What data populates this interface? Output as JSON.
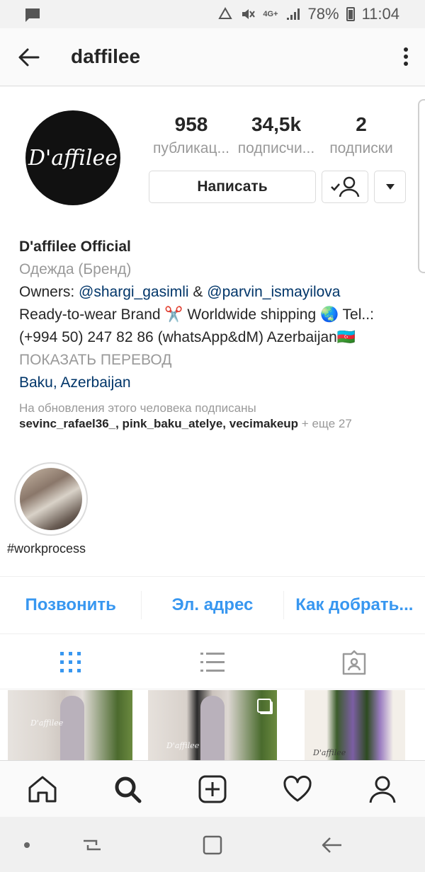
{
  "status_bar": {
    "battery": "78%",
    "time": "11:04",
    "network": "4G+"
  },
  "app_bar": {
    "username": "daffilee"
  },
  "profile": {
    "avatar_text": "D'affilee",
    "stats": [
      {
        "value": "958",
        "label": "публикац..."
      },
      {
        "value": "34,5k",
        "label": "подписчи..."
      },
      {
        "value": "2",
        "label": "подписки"
      }
    ],
    "message_button": "Написать"
  },
  "bio": {
    "name": "D'affilee Official",
    "category": "Одежда (Бренд)",
    "owners_prefix": "Owners: ",
    "owner1": "@shargi_gasimli",
    "owners_amp": " & ",
    "owner2": "@parvin_ismayilova",
    "line3": "Ready-to-wear Brand ✂️ Worldwide shipping 🌏 Tel..: (+994 50) 247 82 86 (whatsApp&dM) Azerbaijan🇦🇿",
    "translate": "ПОКАЗАТЬ ПЕРЕВОД",
    "location": "Baku, Azerbaijan"
  },
  "followed_by": {
    "caption": "На обновления этого человека подписаны",
    "names": "sevinc_rafael36_, pink_baku_atelye, vecimakeup",
    "more": " + еще 27"
  },
  "highlights": [
    {
      "label": "#workprocess"
    }
  ],
  "contact": {
    "call": "Позвонить",
    "email": "Эл. адрес",
    "directions": "Как добрать..."
  },
  "colors": {
    "accent": "#3897f0",
    "link": "#003569",
    "muted": "#999999"
  },
  "icons": {
    "grid_tab": "grid-icon",
    "list_tab": "list-icon",
    "tagged_tab": "tagged-icon",
    "nav": [
      "home-icon",
      "search-icon",
      "add-post-icon",
      "heart-icon",
      "profile-icon"
    ]
  }
}
